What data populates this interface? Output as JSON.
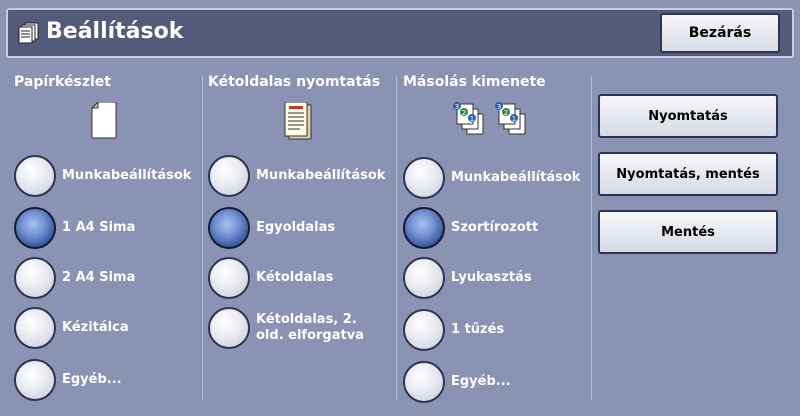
{
  "header": {
    "title": "Beállítások",
    "close_label": "Bezárás",
    "title_icon": "settings-sheet-icon"
  },
  "columns": [
    {
      "title": "Papírkészlet",
      "icon": "blank-page-icon",
      "options": [
        {
          "label": "Munkabeállítások",
          "selected": false
        },
        {
          "label": "1 A4 Sima",
          "selected": true
        },
        {
          "label": "2 A4 Sima",
          "selected": false
        },
        {
          "label": "Kézitálca",
          "selected": false
        },
        {
          "label": "Egyéb...",
          "selected": false
        }
      ]
    },
    {
      "title": "Kétoldalas nyomtatás",
      "icon": "printed-page-icon",
      "options": [
        {
          "label": "Munkabeállítások",
          "selected": false
        },
        {
          "label": "Egyoldalas",
          "selected": true
        },
        {
          "label": "Kétoldalas",
          "selected": false
        },
        {
          "label": "Kétoldalas, 2. old. elforgatva",
          "selected": false
        }
      ]
    },
    {
      "title": "Másolás kimenete",
      "icon": "collated-copies-icon",
      "options": [
        {
          "label": "Munkabeállítások",
          "selected": false
        },
        {
          "label": "Szortírozott",
          "selected": true
        },
        {
          "label": "Lyukasztás",
          "selected": false
        },
        {
          "label": "1 tűzés",
          "selected": false
        },
        {
          "label": "Egyéb...",
          "selected": false
        }
      ]
    }
  ],
  "actions": {
    "print": "Nyomtatás",
    "print_save": "Nyomtatás, mentés",
    "save": "Mentés"
  }
}
